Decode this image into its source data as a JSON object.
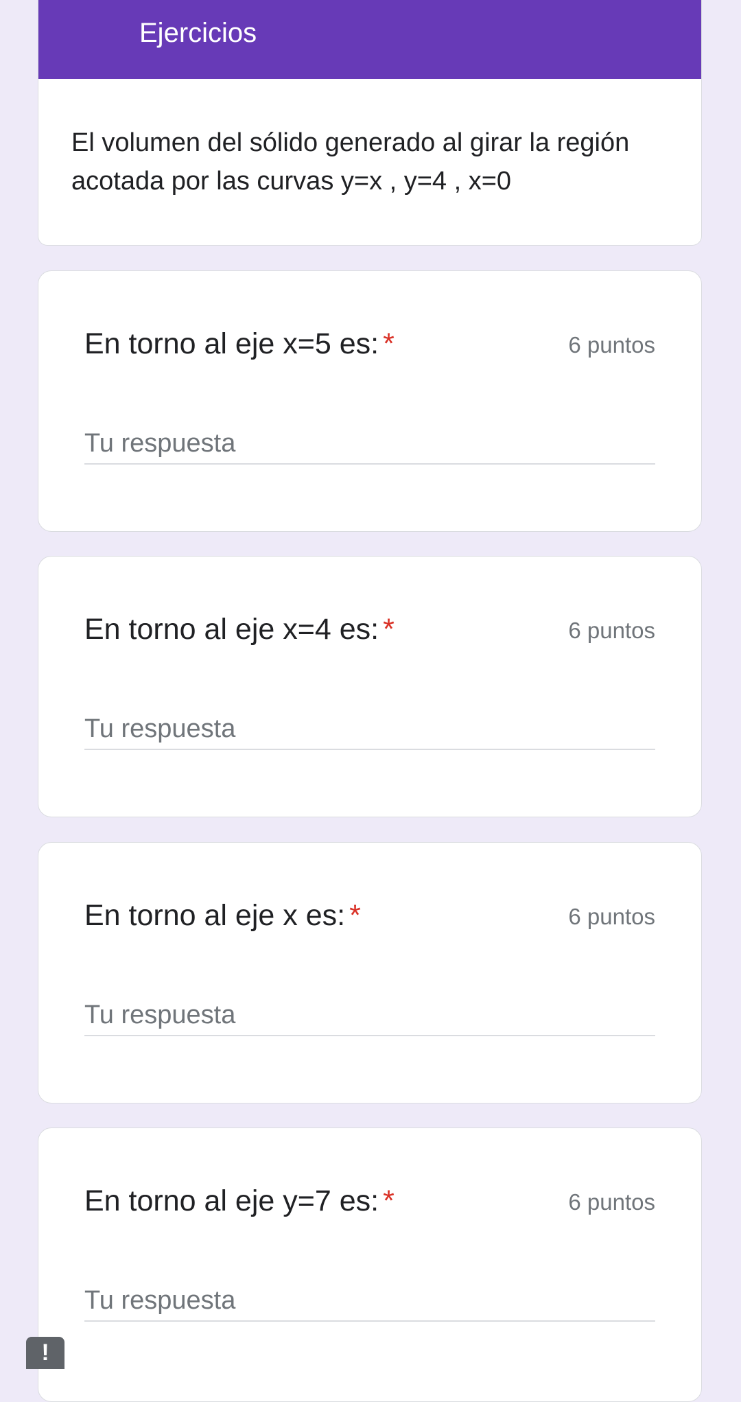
{
  "section": {
    "title": "Ejercicios",
    "description": "El volumen del sólido generado al girar la región acotada por las curvas y=x ,  y=4 , x=0"
  },
  "questions": [
    {
      "title": "En torno al eje x=5 es:",
      "required_mark": "*",
      "points": "6 puntos",
      "placeholder": "Tu respuesta"
    },
    {
      "title": "En torno al eje x=4 es:",
      "required_mark": "*",
      "points": "6 puntos",
      "placeholder": "Tu respuesta"
    },
    {
      "title": "En torno al eje x es:",
      "required_mark": "*",
      "points": "6 puntos",
      "placeholder": "Tu respuesta"
    },
    {
      "title": "En torno al eje y=7 es:",
      "required_mark": "*",
      "points": "6 puntos",
      "placeholder": "Tu respuesta"
    }
  ],
  "report_button": {
    "icon": "exclamation-icon",
    "glyph": "!"
  },
  "colors": {
    "header": "#673AB7",
    "background": "#EEEAF8",
    "required": "#D93025"
  }
}
